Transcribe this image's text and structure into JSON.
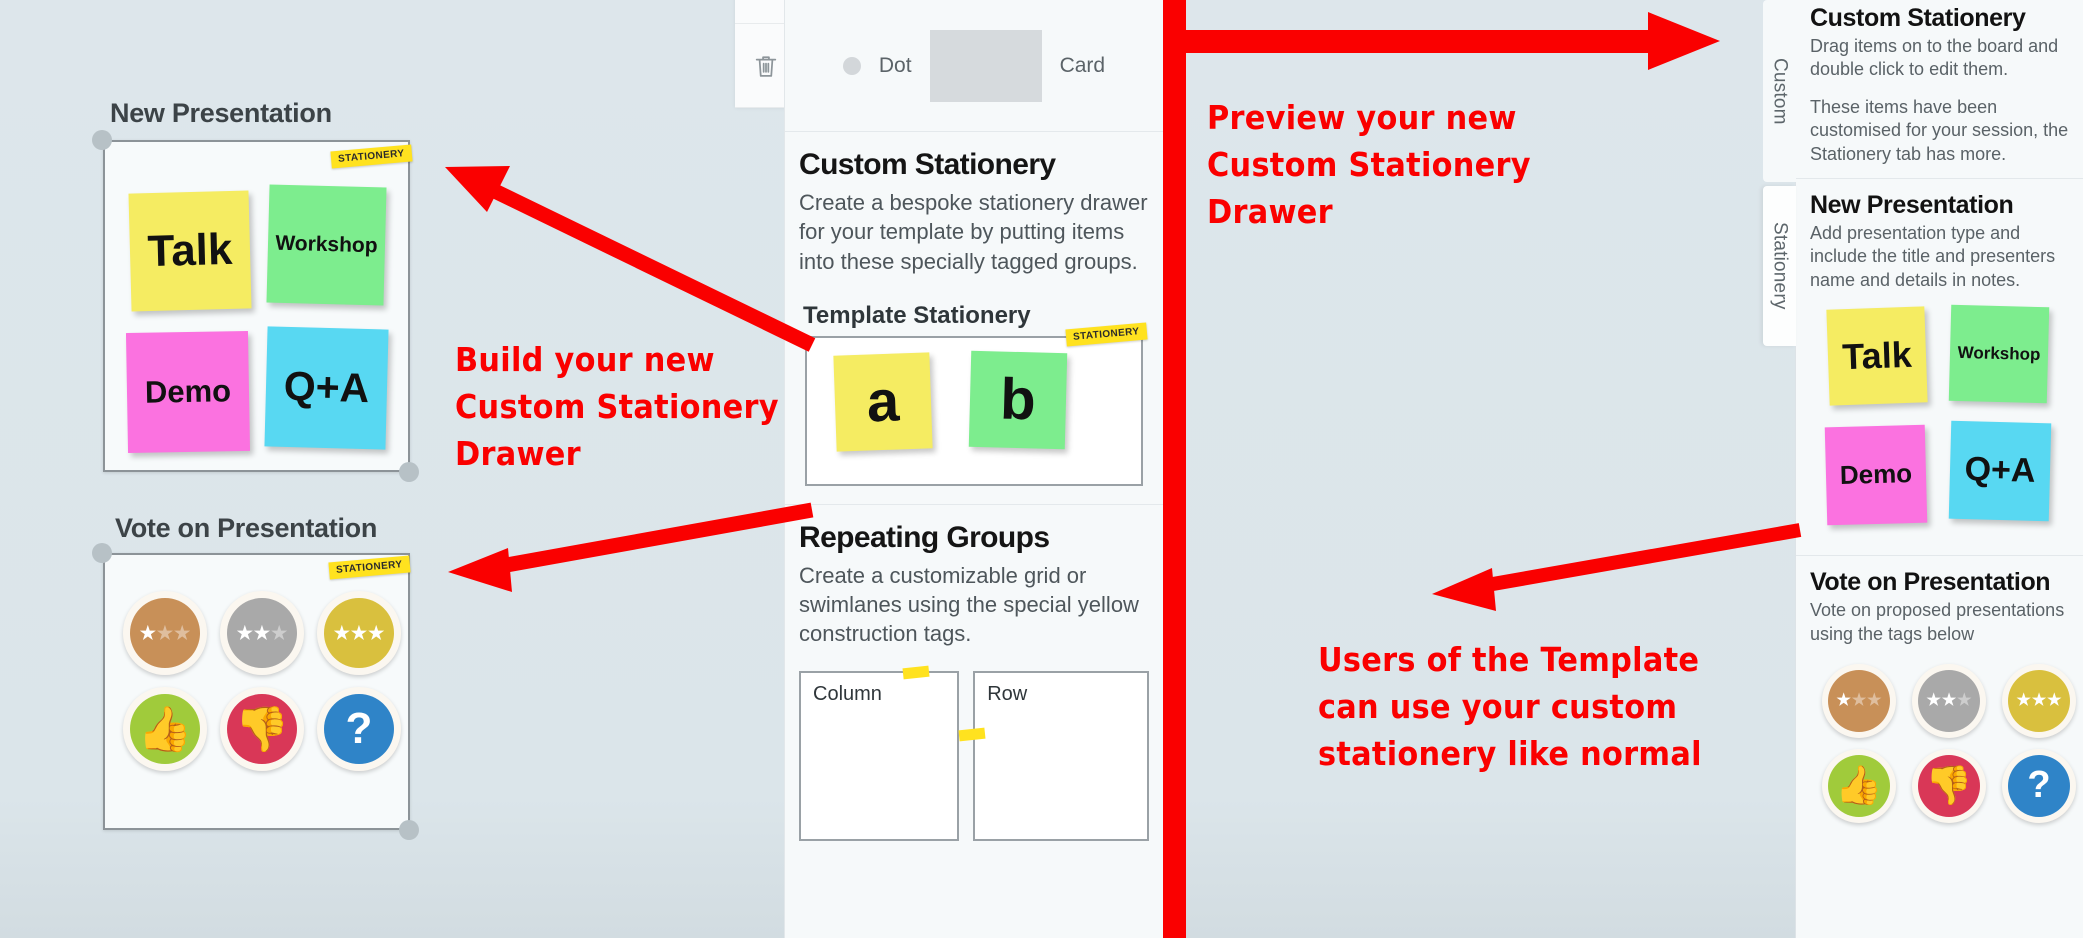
{
  "canvas": {
    "background_color": "#dbe5ea",
    "groups": [
      {
        "title": "New Presentation",
        "tag": "STATIONERY",
        "stickies": [
          {
            "label": "Talk",
            "color": "#f5ec62"
          },
          {
            "label": "Workshop",
            "color": "#7ded8e"
          },
          {
            "label": "Demo",
            "color": "#fb72e0"
          },
          {
            "label": "Q+A",
            "color": "#58d8f2"
          }
        ]
      },
      {
        "title": "Vote on Presentation",
        "tag": "STATIONERY",
        "votes": [
          {
            "name": "one-star-vote",
            "color": "#c89058",
            "type": "stars",
            "filled": 1,
            "total": 3
          },
          {
            "name": "two-star-vote",
            "color": "#a9a9a9",
            "type": "stars",
            "filled": 2,
            "total": 3
          },
          {
            "name": "three-star-vote",
            "color": "#d9c03e",
            "type": "stars",
            "filled": 3,
            "total": 3
          },
          {
            "name": "thumbs-up-vote",
            "color": "#a0cb3b",
            "type": "glyph",
            "glyph": "👍"
          },
          {
            "name": "thumbs-down-vote",
            "color": "#d93757",
            "type": "glyph",
            "glyph": "👎"
          },
          {
            "name": "question-vote",
            "color": "#2f84c8",
            "type": "glyph",
            "glyph": "?"
          }
        ]
      }
    ]
  },
  "toolbar": {
    "buttons": [
      {
        "name": "undo-button",
        "icon": "undo-icon"
      },
      {
        "name": "delete-button",
        "icon": "trash-icon"
      }
    ]
  },
  "center_panel": {
    "dotcard": {
      "dot_label": "Dot",
      "card_label": "Card"
    },
    "sections": [
      {
        "heading": "Custom Stationery",
        "body": "Create a bespoke stationery drawer for your template by putting items into these specially tagged groups.",
        "sub_heading": "Template Stationery",
        "tag": "STATIONERY",
        "stickies": [
          {
            "label": "a",
            "color": "#f5ec62"
          },
          {
            "label": "b",
            "color": "#7ded8e"
          }
        ]
      },
      {
        "heading": "Repeating Groups",
        "body": "Create a customizable grid or swimlanes using the special yellow construction tags.",
        "boxes": [
          {
            "label": "Column"
          },
          {
            "label": "Row"
          }
        ]
      }
    ]
  },
  "right_sidebar": {
    "tabs": [
      {
        "label": "Custom",
        "active": false
      },
      {
        "label": "Stationery",
        "active": true
      }
    ],
    "sections": [
      {
        "heading": "Custom Stationery",
        "paragraphs": [
          "Drag items on to the board and double click to edit them.",
          "These items have been customised for your session, the Stationery tab has more."
        ]
      },
      {
        "heading": "New Presentation",
        "paragraphs": [
          "Add presentation type and include the title and presenters name and details in notes."
        ],
        "stickies": [
          {
            "label": "Talk",
            "color": "#f5ec62"
          },
          {
            "label": "Workshop",
            "color": "#7ded8e"
          },
          {
            "label": "Demo",
            "color": "#fb72e0"
          },
          {
            "label": "Q+A",
            "color": "#58d8f2"
          }
        ]
      },
      {
        "heading": "Vote on Presentation",
        "paragraphs": [
          "Vote on proposed presentations using the tags below"
        ],
        "votes": [
          {
            "name": "one-star-vote",
            "color": "#c89058",
            "type": "stars",
            "filled": 1,
            "total": 3
          },
          {
            "name": "two-star-vote",
            "color": "#a9a9a9",
            "type": "stars",
            "filled": 2,
            "total": 3
          },
          {
            "name": "three-star-vote",
            "color": "#d9c03e",
            "type": "stars",
            "filled": 3,
            "total": 3
          },
          {
            "name": "thumbs-up-vote",
            "color": "#a0cb3b",
            "type": "glyph",
            "glyph": "👍"
          },
          {
            "name": "thumbs-down-vote",
            "color": "#d93757",
            "type": "glyph",
            "glyph": "👎"
          },
          {
            "name": "question-vote",
            "color": "#2f84c8",
            "type": "glyph",
            "glyph": "?"
          }
        ]
      }
    ]
  },
  "annotations": {
    "color": "#fa0000",
    "notes": [
      {
        "name": "annotation-build-drawer",
        "text": "Build your new\nCustom Stationery\nDrawer"
      },
      {
        "name": "annotation-preview-drawer",
        "text": "Preview your new\nCustom Stationery\nDrawer"
      },
      {
        "name": "annotation-users-template",
        "text": "Users of the Template\ncan use your custom\nstationery like normal"
      }
    ]
  }
}
